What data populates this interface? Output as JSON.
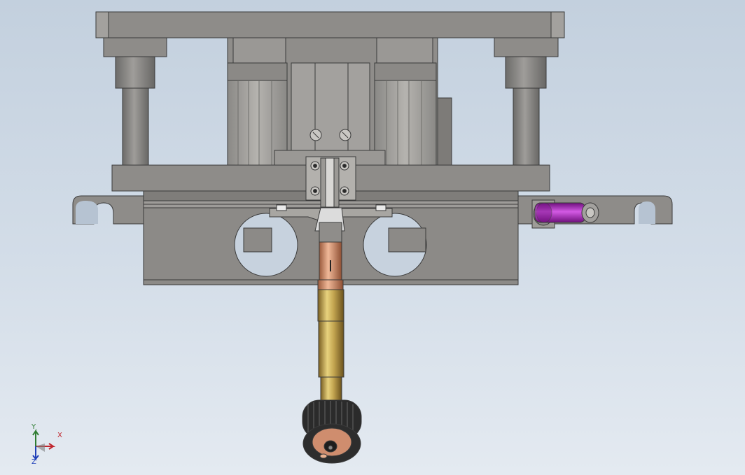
{
  "viewport": {
    "background_top": "#c3d0de",
    "background_bottom": "#e4eaf1"
  },
  "colors": {
    "steel": "#8e8c89",
    "steel_dark": "#5f5e5c",
    "steel_light": "#a9a7a3",
    "brass": "#b99a45",
    "copper": "#c98a66",
    "purple": "#a321b3",
    "knob": "#2b2b2b",
    "outline": "#3a3a3a"
  },
  "triad": {
    "x_label": "X",
    "y_label": "Y",
    "z_label": "Z",
    "x_color": "#c0262e",
    "y_color": "#2f7d32",
    "z_color": "#1f3fb8"
  }
}
